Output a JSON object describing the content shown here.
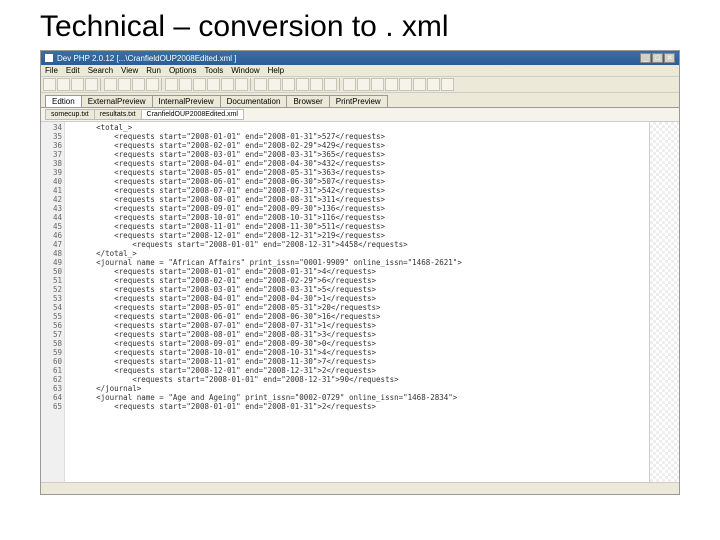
{
  "slide": {
    "title": "Technical – conversion to . xml"
  },
  "titlebar": {
    "app": "Dev PHP 2.0.12",
    "doc": "[...\\CranfieldOUP2008Edited.xml ]"
  },
  "winbuttons": {
    "min": "_",
    "max": "□",
    "close": "✕"
  },
  "menu": [
    "File",
    "Edit",
    "Search",
    "View",
    "Run",
    "Options",
    "Tools",
    "Window",
    "Help"
  ],
  "tabs": [
    "Edtion",
    "ExternalPreview",
    "InternalPreview",
    "Documentation",
    "Browser",
    "PrintPreview"
  ],
  "filetabs": [
    "somecup.txt",
    "resultats.txt",
    "CranfieldOUP2008Edited.xml"
  ],
  "startLine": 34,
  "code": [
    "      <total_>",
    "          <requests start=\"2008-01-01\" end=\"2008-01-31\">527</requests>",
    "          <requests start=\"2008-02-01\" end=\"2008-02-29\">429</requests>",
    "          <requests start=\"2008-03-01\" end=\"2008-03-31\">365</requests>",
    "          <requests start=\"2008-04-01\" end=\"2008-04-30\">432</requests>",
    "          <requests start=\"2008-05-01\" end=\"2008-05-31\">363</requests>",
    "          <requests start=\"2008-06-01\" end=\"2008-06-30\">507</requests>",
    "          <requests start=\"2008-07-01\" end=\"2008-07-31\">542</requests>",
    "          <requests start=\"2008-08-01\" end=\"2008-08-31\">311</requests>",
    "          <requests start=\"2008-09-01\" end=\"2008-09-30\">136</requests>",
    "          <requests start=\"2008-10-01\" end=\"2008-10-31\">116</requests>",
    "          <requests start=\"2008-11-01\" end=\"2008-11-30\">511</requests>",
    "          <requests start=\"2008-12-01\" end=\"2008-12-31\">219</requests>",
    "              <requests start=\"2008-01-01\" end=\"2008-12-31\">4458</requests>",
    "      </total_>",
    "      <journal name = \"African Affairs\" print_issn=\"0001-9909\" online_issn=\"1468-2621\">",
    "          <requests start=\"2008-01-01\" end=\"2008-01-31\">4</requests>",
    "          <requests start=\"2008-02-01\" end=\"2008-02-29\">6</requests>",
    "          <requests start=\"2008-03-01\" end=\"2008-03-31\">5</requests>",
    "          <requests start=\"2008-04-01\" end=\"2008-04-30\">1</requests>",
    "          <requests start=\"2008-05-01\" end=\"2008-05-31\">20</requests>",
    "          <requests start=\"2008-06-01\" end=\"2008-06-30\">16</requests>",
    "          <requests start=\"2008-07-01\" end=\"2008-07-31\">1</requests>",
    "          <requests start=\"2008-08-01\" end=\"2008-08-31\">3</requests>",
    "          <requests start=\"2008-09-01\" end=\"2008-09-30\">0</requests>",
    "          <requests start=\"2008-10-01\" end=\"2008-10-31\">4</requests>",
    "          <requests start=\"2008-11-01\" end=\"2008-11-30\">7</requests>",
    "          <requests start=\"2008-12-01\" end=\"2008-12-31\">2</requests>",
    "              <requests start=\"2008-01-01\" end=\"2008-12-31\">90</requests>",
    "      </journal>",
    "      <journal name = \"Age and Ageing\" print_issn=\"0002-0729\" online_issn=\"1468-2834\">",
    "          <requests start=\"2008-01-01\" end=\"2008-01-31\">2</requests>"
  ]
}
